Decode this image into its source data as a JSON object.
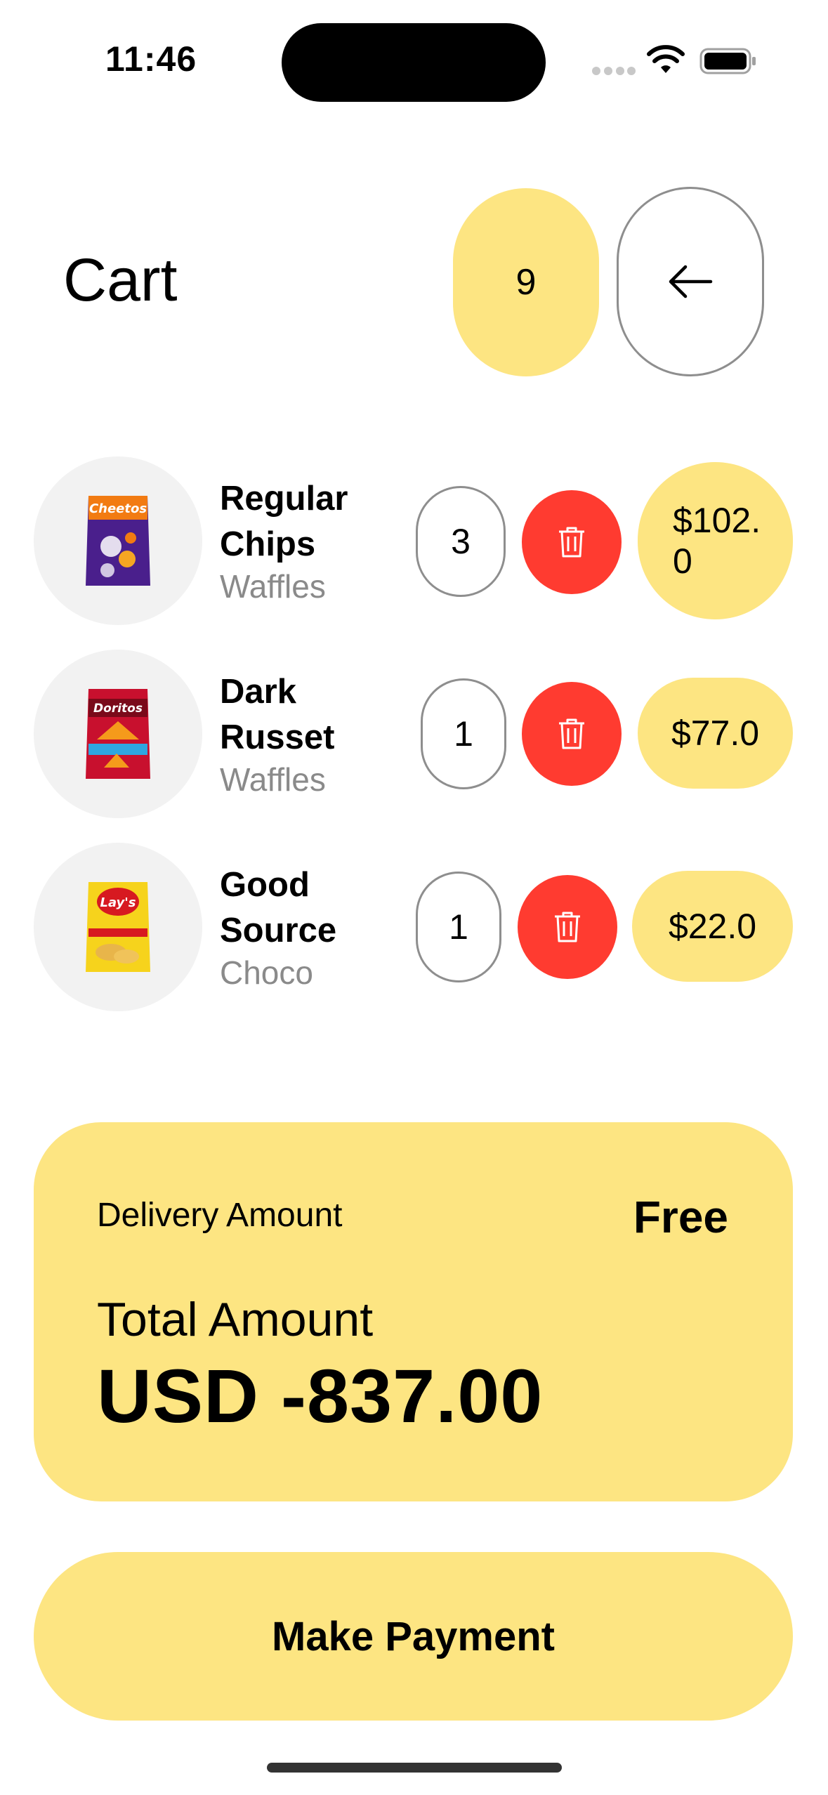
{
  "status_bar": {
    "time": "11:46"
  },
  "header": {
    "title": "Cart",
    "cart_count": "9"
  },
  "items": [
    {
      "name_line1": "Regular",
      "name_line2": "Chips",
      "subtitle": "Waffles",
      "quantity": "3",
      "price_line1": "$102.",
      "price_line2": "0",
      "image": "cheetos-bag",
      "product_brand": "Cheetos"
    },
    {
      "name_line1": "Dark",
      "name_line2": "Russet",
      "subtitle": "Waffles",
      "quantity": "1",
      "price_line1": "$77.0",
      "price_line2": "",
      "image": "doritos-bag",
      "product_brand": "Doritos"
    },
    {
      "name_line1": "Good",
      "name_line2": "Source",
      "subtitle": "Choco",
      "quantity": "1",
      "price_line1": "$22.0",
      "price_line2": "",
      "image": "lays-bag",
      "product_brand": "Lay's"
    }
  ],
  "summary": {
    "delivery_label": "Delivery Amount",
    "delivery_value": "Free",
    "total_label": "Total Amount",
    "total_value": "USD -837.00"
  },
  "payment_button": "Make Payment",
  "colors": {
    "accent_yellow": "#fde582",
    "delete_red": "#ff3b30",
    "muted_text": "#8a8a8a",
    "outline": "#8e8e8e"
  },
  "icons": {
    "back": "arrow-left-icon",
    "delete": "trash-icon"
  }
}
